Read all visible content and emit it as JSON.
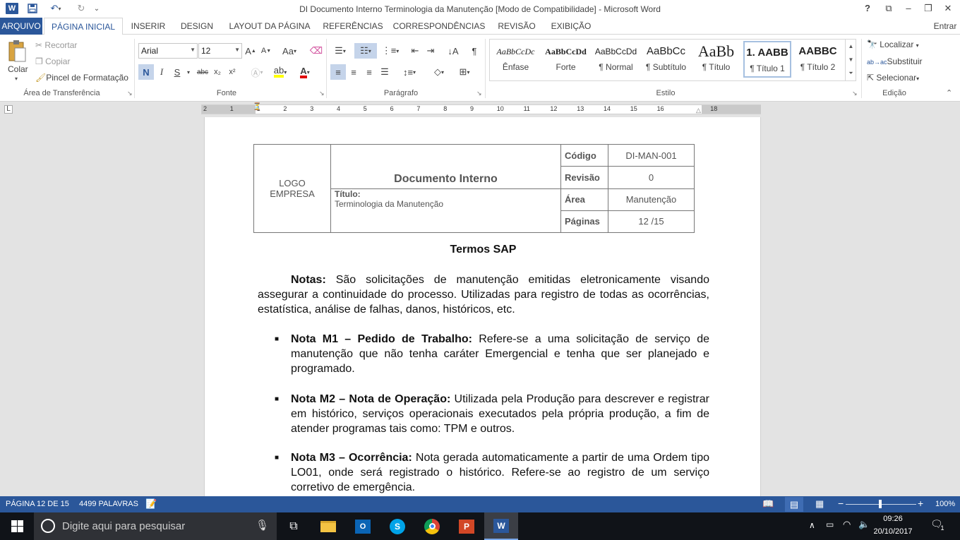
{
  "app": {
    "title": "DI  Documento Interno Terminologia da Manutenção [Modo de Compatibilidade] - Microsoft Word",
    "help": "?",
    "user": "Entrar"
  },
  "tabs": [
    "ARQUIVO",
    "PÁGINA INICIAL",
    "INSERIR",
    "DESIGN",
    "LAYOUT DA PÁGINA",
    "REFERÊNCIAS",
    "CORRESPONDÊNCIAS",
    "REVISÃO",
    "EXIBIÇÃO"
  ],
  "ribbon": {
    "clipboard": {
      "paste": "Colar",
      "cut": "Recortar",
      "copy": "Copiar",
      "painter": "Pincel de Formatação",
      "label": "Área de Transferência"
    },
    "font": {
      "name": "Arial",
      "size": "12",
      "label": "Fonte",
      "bold": "N",
      "italic": "I",
      "underline": "S",
      "strike": "abc",
      "sub": "x₂",
      "sup": "x²",
      "case": "Aa"
    },
    "paragraph": {
      "label": "Parágrafo"
    },
    "styles": {
      "label": "Estilo",
      "items": [
        {
          "preview": "AaBbCcDc",
          "name": "Ênfase"
        },
        {
          "preview": "AaBbCcDd",
          "name": "Forte"
        },
        {
          "preview": "AaBbCcDd",
          "name": "¶ Normal"
        },
        {
          "preview": "AaBbCc",
          "name": "¶ Subtítulo"
        },
        {
          "preview": "AaBb",
          "name": "¶ Título"
        },
        {
          "preview": "1.  AABB",
          "name": "¶ Título 1"
        },
        {
          "preview": "AABBC",
          "name": "¶ Título 2"
        }
      ]
    },
    "editing": {
      "find": "Localizar",
      "replace": "Substituir",
      "select": "Selecionar",
      "label": "Edição"
    }
  },
  "ruler": {
    "numbers": [
      "2",
      "1",
      "1",
      "2",
      "3",
      "4",
      "5",
      "6",
      "7",
      "8",
      "9",
      "10",
      "11",
      "12",
      "13",
      "14",
      "15",
      "16",
      "18"
    ]
  },
  "doc": {
    "header": {
      "logo": "LOGO EMPRESA",
      "doc_title": "Documento Interno",
      "title_label": "Título:",
      "title_value": "Terminologia da Manutenção",
      "codigo_label": "Código",
      "codigo": "DI-MAN-001",
      "revisao_label": "Revisão",
      "revisao": "0",
      "area_label": "Área",
      "area": "Manutenção",
      "paginas_label": "Páginas",
      "paginas": "12 /15"
    },
    "heading": "Termos SAP",
    "notas_label": "Notas:",
    "notas_text": " São solicitações de manutenção emitidas eletronicamente visando assegurar a continuidade do processo. Utilizadas para registro de todas as ocorrências, estatística, análise de falhas, danos, históricos, etc.",
    "items": [
      {
        "bold": "Nota M1 – Pedido de Trabalho:",
        "text": " Refere-se a uma solicitação de serviço de manutenção que não tenha caráter Emergencial e tenha que ser planejado e programado."
      },
      {
        "bold": "Nota M2 – Nota de Operação:",
        "text": " Utilizada pela Produção para descrever e registrar em histórico, serviços operacionais executados pela própria produção, a fim de atender programas tais como: TPM e outros."
      },
      {
        "bold": "Nota M3 – Ocorrência:",
        "text": " Nota gerada automaticamente a partir de uma Ordem tipo LO01, onde será registrado o histórico. Refere-se ao registro de um serviço corretivo de emergência."
      }
    ]
  },
  "status": {
    "page": "PÁGINA 12 DE 15",
    "words": "4499 PALAVRAS",
    "zoom": "100%",
    "zoom_level": 1.0
  },
  "taskbar": {
    "search_placeholder": "Digite aqui para pesquisar",
    "time": "09:26",
    "date": "20/10/2017",
    "notif_count": "1"
  }
}
